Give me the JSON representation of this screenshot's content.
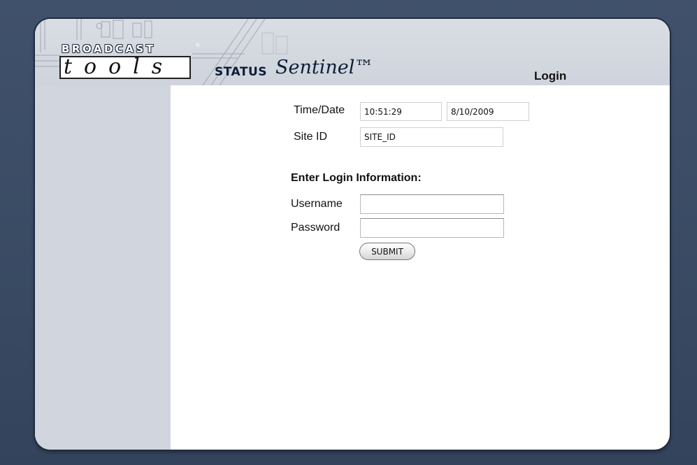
{
  "header": {
    "logo_broadcast": "BROADCAST",
    "logo_registered": "®",
    "logo_tools": "tools",
    "product_status": "STATUS",
    "product_sentinel": "Sentinel™",
    "page_title": "Login"
  },
  "system_info": {
    "time_date_label": "Time/Date",
    "time_value": "10:51:29",
    "date_value": "8/10/2009",
    "site_id_label": "Site ID",
    "site_id_value": "SITE_ID"
  },
  "login": {
    "section_title": "Enter Login Information:",
    "username_label": "Username",
    "username_value": "",
    "password_label": "Password",
    "password_value": "",
    "submit_label": "SUBMIT"
  },
  "colors": {
    "background": "#3a4b64",
    "header": "#d9dde4",
    "sidebar": "#d1d6de",
    "content": "#ffffff",
    "brand_navy": "#0f1d38"
  }
}
